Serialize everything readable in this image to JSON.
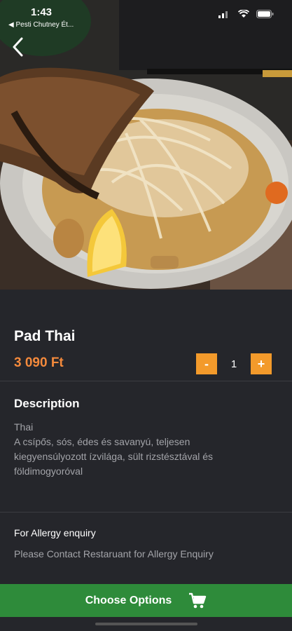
{
  "status_bar": {
    "time": "1:43",
    "back_app": "◀ Pesti Chutney Ét...",
    "icons": [
      "signal-icon",
      "wifi-icon",
      "battery-icon"
    ]
  },
  "nav": {
    "back_icon": "chevron-left-icon"
  },
  "hero": {
    "image": "pad-thai-photo"
  },
  "product": {
    "name": "Pad Thai",
    "price": "3 090 Ft",
    "quantity": {
      "minus_label": "-",
      "value": "1",
      "plus_label": "+"
    }
  },
  "description": {
    "heading": "Description",
    "category": "Thai",
    "text": "A csípős, sós, édes és savanyú, teljesen kiegyensúlyozott ízvilága, sült rizstésztával és földimogyoróval"
  },
  "allergy": {
    "heading": "For Allergy enquiry",
    "text": "Please Contact Restaruant for Allergy Enquiry"
  },
  "cta": {
    "label": "Choose Options",
    "icon": "cart-icon"
  },
  "colors": {
    "background": "#25262b",
    "accent": "#f39a2b",
    "price": "#f48a3c",
    "cta": "#2e8b3a"
  }
}
